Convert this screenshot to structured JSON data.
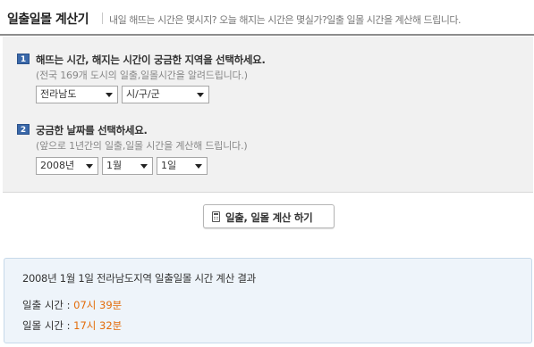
{
  "header": {
    "title": "일출일몰 계산기",
    "subtitle": "내일 해뜨는 시간은 몇시지? 오늘 해지는 시간은 몇실가?일출 일몰 시간을 계산해 드립니다."
  },
  "step1": {
    "number": "1",
    "title": "해뜨는 시간, 해지는 시간이 궁금한 지역을 선택하세요.",
    "description": "(전국 169개 도시의 일출,일몰시간을 알려드립니다.)",
    "province_select": "전라남도",
    "city_select": "시/구/군"
  },
  "step2": {
    "number": "2",
    "title": "궁금한 날짜를 선택하세요.",
    "description": "(앞으로 1년간의 일출,일몰 시간을 계산해 드립니다.)",
    "year_select": "2008년",
    "month_select": "1월",
    "day_select": "1일"
  },
  "calculate_button": {
    "label": "일출, 일몰 계산 하기",
    "icon": "calculator-icon"
  },
  "result": {
    "title": "2008년 1월 1일 전라남도지역 일출일몰 시간 계산 결과",
    "sunrise_label": "일출 시간 : ",
    "sunrise_value": "07시 39분",
    "sunset_label": "일몰 시간 : ",
    "sunset_value": "17시 32분"
  },
  "colors": {
    "accent_orange": "#e36c0a",
    "step_badge": "#3a68a9",
    "result_bg": "#eef4fa"
  }
}
